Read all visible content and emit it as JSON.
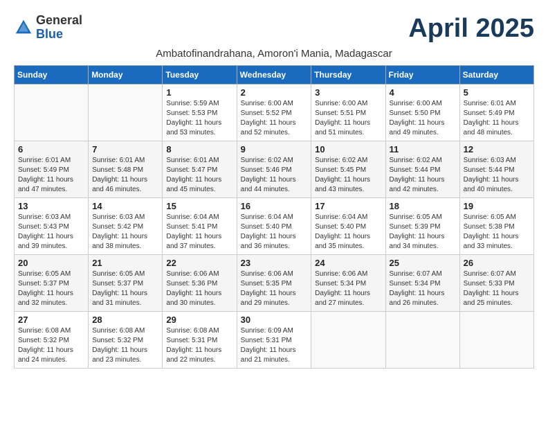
{
  "logo": {
    "general": "General",
    "blue": "Blue"
  },
  "title": "April 2025",
  "subtitle": "Ambatofinandrahana, Amoron'i Mania, Madagascar",
  "days_header": [
    "Sunday",
    "Monday",
    "Tuesday",
    "Wednesday",
    "Thursday",
    "Friday",
    "Saturday"
  ],
  "weeks": [
    [
      {
        "num": "",
        "info": ""
      },
      {
        "num": "",
        "info": ""
      },
      {
        "num": "1",
        "info": "Sunrise: 5:59 AM\nSunset: 5:53 PM\nDaylight: 11 hours and 53 minutes."
      },
      {
        "num": "2",
        "info": "Sunrise: 6:00 AM\nSunset: 5:52 PM\nDaylight: 11 hours and 52 minutes."
      },
      {
        "num": "3",
        "info": "Sunrise: 6:00 AM\nSunset: 5:51 PM\nDaylight: 11 hours and 51 minutes."
      },
      {
        "num": "4",
        "info": "Sunrise: 6:00 AM\nSunset: 5:50 PM\nDaylight: 11 hours and 49 minutes."
      },
      {
        "num": "5",
        "info": "Sunrise: 6:01 AM\nSunset: 5:49 PM\nDaylight: 11 hours and 48 minutes."
      }
    ],
    [
      {
        "num": "6",
        "info": "Sunrise: 6:01 AM\nSunset: 5:49 PM\nDaylight: 11 hours and 47 minutes."
      },
      {
        "num": "7",
        "info": "Sunrise: 6:01 AM\nSunset: 5:48 PM\nDaylight: 11 hours and 46 minutes."
      },
      {
        "num": "8",
        "info": "Sunrise: 6:01 AM\nSunset: 5:47 PM\nDaylight: 11 hours and 45 minutes."
      },
      {
        "num": "9",
        "info": "Sunrise: 6:02 AM\nSunset: 5:46 PM\nDaylight: 11 hours and 44 minutes."
      },
      {
        "num": "10",
        "info": "Sunrise: 6:02 AM\nSunset: 5:45 PM\nDaylight: 11 hours and 43 minutes."
      },
      {
        "num": "11",
        "info": "Sunrise: 6:02 AM\nSunset: 5:44 PM\nDaylight: 11 hours and 42 minutes."
      },
      {
        "num": "12",
        "info": "Sunrise: 6:03 AM\nSunset: 5:44 PM\nDaylight: 11 hours and 40 minutes."
      }
    ],
    [
      {
        "num": "13",
        "info": "Sunrise: 6:03 AM\nSunset: 5:43 PM\nDaylight: 11 hours and 39 minutes."
      },
      {
        "num": "14",
        "info": "Sunrise: 6:03 AM\nSunset: 5:42 PM\nDaylight: 11 hours and 38 minutes."
      },
      {
        "num": "15",
        "info": "Sunrise: 6:04 AM\nSunset: 5:41 PM\nDaylight: 11 hours and 37 minutes."
      },
      {
        "num": "16",
        "info": "Sunrise: 6:04 AM\nSunset: 5:40 PM\nDaylight: 11 hours and 36 minutes."
      },
      {
        "num": "17",
        "info": "Sunrise: 6:04 AM\nSunset: 5:40 PM\nDaylight: 11 hours and 35 minutes."
      },
      {
        "num": "18",
        "info": "Sunrise: 6:05 AM\nSunset: 5:39 PM\nDaylight: 11 hours and 34 minutes."
      },
      {
        "num": "19",
        "info": "Sunrise: 6:05 AM\nSunset: 5:38 PM\nDaylight: 11 hours and 33 minutes."
      }
    ],
    [
      {
        "num": "20",
        "info": "Sunrise: 6:05 AM\nSunset: 5:37 PM\nDaylight: 11 hours and 32 minutes."
      },
      {
        "num": "21",
        "info": "Sunrise: 6:05 AM\nSunset: 5:37 PM\nDaylight: 11 hours and 31 minutes."
      },
      {
        "num": "22",
        "info": "Sunrise: 6:06 AM\nSunset: 5:36 PM\nDaylight: 11 hours and 30 minutes."
      },
      {
        "num": "23",
        "info": "Sunrise: 6:06 AM\nSunset: 5:35 PM\nDaylight: 11 hours and 29 minutes."
      },
      {
        "num": "24",
        "info": "Sunrise: 6:06 AM\nSunset: 5:34 PM\nDaylight: 11 hours and 27 minutes."
      },
      {
        "num": "25",
        "info": "Sunrise: 6:07 AM\nSunset: 5:34 PM\nDaylight: 11 hours and 26 minutes."
      },
      {
        "num": "26",
        "info": "Sunrise: 6:07 AM\nSunset: 5:33 PM\nDaylight: 11 hours and 25 minutes."
      }
    ],
    [
      {
        "num": "27",
        "info": "Sunrise: 6:08 AM\nSunset: 5:32 PM\nDaylight: 11 hours and 24 minutes."
      },
      {
        "num": "28",
        "info": "Sunrise: 6:08 AM\nSunset: 5:32 PM\nDaylight: 11 hours and 23 minutes."
      },
      {
        "num": "29",
        "info": "Sunrise: 6:08 AM\nSunset: 5:31 PM\nDaylight: 11 hours and 22 minutes."
      },
      {
        "num": "30",
        "info": "Sunrise: 6:09 AM\nSunset: 5:31 PM\nDaylight: 11 hours and 21 minutes."
      },
      {
        "num": "",
        "info": ""
      },
      {
        "num": "",
        "info": ""
      },
      {
        "num": "",
        "info": ""
      }
    ]
  ]
}
